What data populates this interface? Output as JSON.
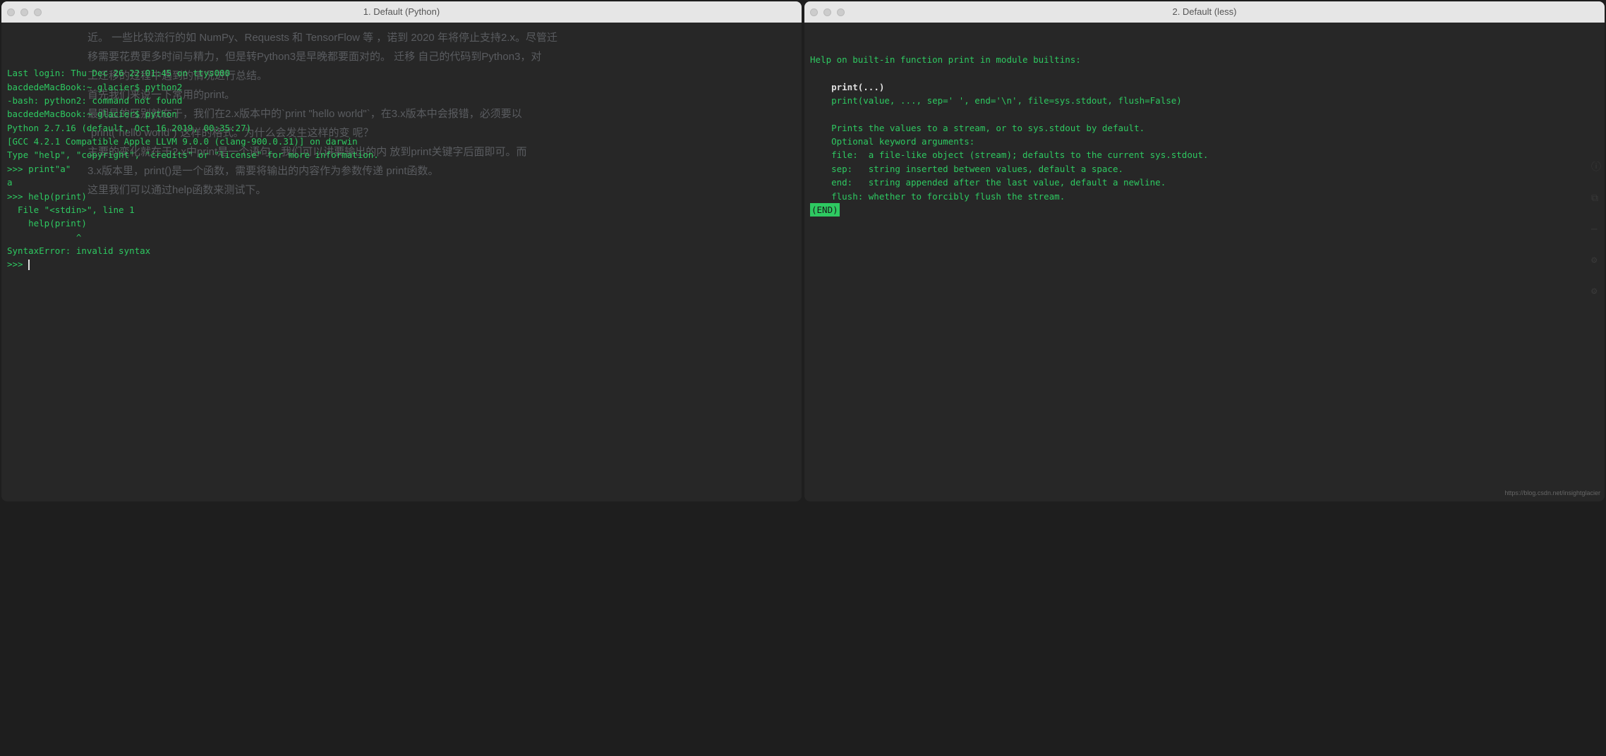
{
  "panes": {
    "left": {
      "title": "1. Default (Python)",
      "bg_lines": [
        "近。 一些比较流行的如 NumPy、Requests 和 TensorFlow 等 ，诺到 2020 年将停止支持2.x。尽管迁",
        "移需要花费更多时间与精力，但是转Python3是早晚都要面对的。   迁移   自己的代码到Python3，对",
        "工迁移的过程中遇到的情况进行总结。",
        "",
        "首先我们来说一下常用的print。",
        "最明显的区别就在于，我们在2.x版本中的`print \"hello world\"`，在3.x版本中会报错，必须要以",
        "`print(\"hello world\")`这样的格式。为什么会发生这样的变   呢？",
        "主要的变化就在于2.x中print是一个语句，我们可以讲要输出的内   放到print关键字后面即可。而",
        "3.x版本里，print()是一个函数，需要将输出的内容作为参数传递   print函数。",
        "这里我们可以通过help函数来测试下。"
      ],
      "lines": [
        {
          "t": "green",
          "v": "Last login: Thu Dec 26 22:01:45 on ttys000"
        },
        {
          "t": "green",
          "v": "bacdedeMacBook:~ glacier$ python2"
        },
        {
          "t": "green",
          "v": "-bash: python2: command not found"
        },
        {
          "t": "green",
          "v": "bacdedeMacBook:~ glacier$ python"
        },
        {
          "t": "green",
          "v": "Python 2.7.16 (default, Oct 16 2019, 00:35:27)"
        },
        {
          "t": "green",
          "v": "[GCC 4.2.1 Compatible Apple LLVM 9.0.0 (clang-900.0.31)] on darwin"
        },
        {
          "t": "green",
          "v": "Type \"help\", \"copyright\", \"credits\" or \"license\" for more information."
        },
        {
          "t": "green",
          "v": ">>> print\"a\""
        },
        {
          "t": "green",
          "v": "a"
        },
        {
          "t": "green",
          "v": ">>> help(print)"
        },
        {
          "t": "green",
          "v": "  File \"<stdin>\", line 1"
        },
        {
          "t": "green",
          "v": "    help(print)"
        },
        {
          "t": "green",
          "v": "             ^"
        },
        {
          "t": "green",
          "v": "SyntaxError: invalid syntax"
        },
        {
          "t": "promptcursor",
          "v": ">>> "
        }
      ]
    },
    "right": {
      "title": "2. Default (less)",
      "lines": [
        {
          "t": "green",
          "v": "Help on built-in function print in module builtins:"
        },
        {
          "t": "green",
          "v": ""
        },
        {
          "t": "bold",
          "v": "print(...)"
        },
        {
          "t": "green",
          "v": "    print(value, ..., sep=' ', end='\\n', file=sys.stdout, flush=False)"
        },
        {
          "t": "green",
          "v": ""
        },
        {
          "t": "green",
          "v": "    Prints the values to a stream, or to sys.stdout by default."
        },
        {
          "t": "green",
          "v": "    Optional keyword arguments:"
        },
        {
          "t": "green",
          "v": "    file:  a file-like object (stream); defaults to the current sys.stdout."
        },
        {
          "t": "green",
          "v": "    sep:   string inserted between values, default a space."
        },
        {
          "t": "green",
          "v": "    end:   string appended after the last value, default a newline."
        },
        {
          "t": "green",
          "v": "    flush: whether to forcibly flush the stream."
        },
        {
          "t": "end",
          "v": "(END)"
        }
      ],
      "watermark": "https://blog.csdn.net/insightglacier"
    }
  }
}
